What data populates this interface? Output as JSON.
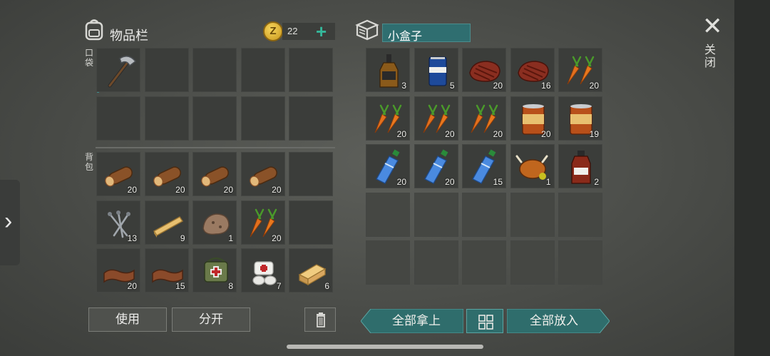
{
  "inventory": {
    "title": "物品栏",
    "coins": "22",
    "plus": "+",
    "pocket_label": "口袋",
    "backpack_label": "背包",
    "pocket_slots": [
      {
        "item": "axe-icon",
        "count": ""
      },
      {
        "item": "",
        "count": ""
      },
      {
        "item": "",
        "count": ""
      },
      {
        "item": "",
        "count": ""
      },
      {
        "item": "",
        "count": ""
      },
      {
        "item": "",
        "count": ""
      },
      {
        "item": "",
        "count": ""
      },
      {
        "item": "",
        "count": ""
      },
      {
        "item": "",
        "count": ""
      },
      {
        "item": "",
        "count": ""
      }
    ],
    "backpack_slots": [
      {
        "item": "log-icon",
        "count": "20"
      },
      {
        "item": "log-icon",
        "count": "20"
      },
      {
        "item": "log-icon",
        "count": "20"
      },
      {
        "item": "log-icon",
        "count": "20"
      },
      {
        "item": "",
        "count": ""
      },
      {
        "item": "nails-icon",
        "count": "13"
      },
      {
        "item": "plank-icon",
        "count": "9"
      },
      {
        "item": "stone-icon",
        "count": "1"
      },
      {
        "item": "carrot-icon",
        "count": "20"
      },
      {
        "item": "",
        "count": ""
      },
      {
        "item": "leather-icon",
        "count": "20"
      },
      {
        "item": "leather-icon",
        "count": "15"
      },
      {
        "item": "first-aid-bag-icon",
        "count": "8"
      },
      {
        "item": "bandage-icon",
        "count": "7"
      },
      {
        "item": "wood-block-icon",
        "count": "6"
      }
    ],
    "use_label": "使用",
    "split_label": "分开"
  },
  "container": {
    "name": "小盒子",
    "slots": [
      {
        "item": "whiskey-bottle-icon",
        "count": "3"
      },
      {
        "item": "beer-can-icon",
        "count": "5"
      },
      {
        "item": "steak-icon",
        "count": "20"
      },
      {
        "item": "steak-icon",
        "count": "16"
      },
      {
        "item": "carrot-icon",
        "count": "20"
      },
      {
        "item": "carrot-icon",
        "count": "20"
      },
      {
        "item": "carrot-icon",
        "count": "20"
      },
      {
        "item": "carrot-icon",
        "count": "20"
      },
      {
        "item": "canned-food-icon",
        "count": "20"
      },
      {
        "item": "canned-food-icon",
        "count": "19"
      },
      {
        "item": "water-bottle-icon",
        "count": "20"
      },
      {
        "item": "water-bottle-icon",
        "count": "20"
      },
      {
        "item": "water-bottle-icon",
        "count": "15"
      },
      {
        "item": "roast-chicken-icon",
        "count": "1"
      },
      {
        "item": "syrup-bottle-icon",
        "count": "2"
      }
    ],
    "take_all_label": "全部拿上",
    "put_all_label": "全部放入"
  },
  "close_label": "关闭"
}
